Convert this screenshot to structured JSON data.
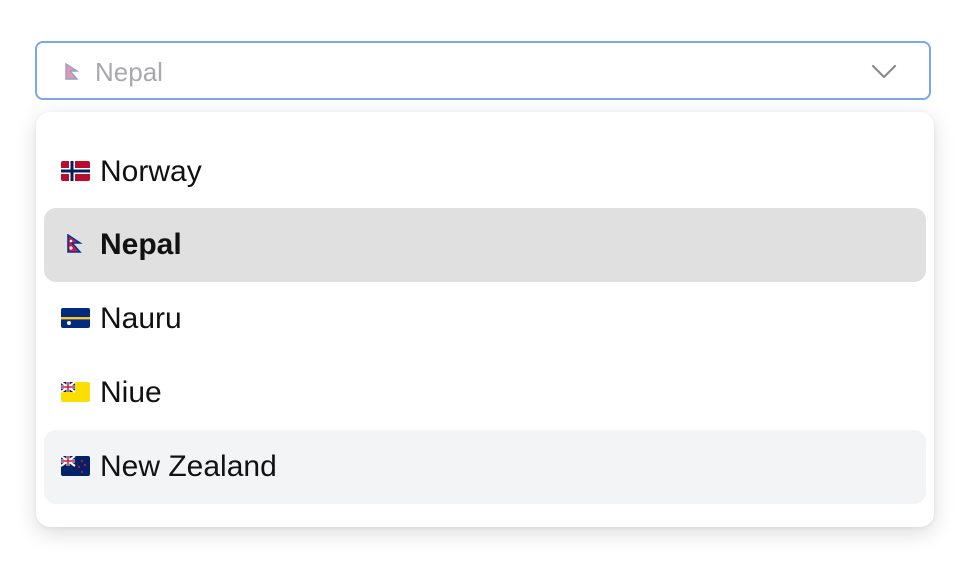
{
  "select": {
    "selected_value": "Nepal",
    "selected_flag": "nepal-flag-icon",
    "chevron_icon": "chevron-down-icon"
  },
  "options": [
    {
      "label": "Norway",
      "flag": "norway-flag-icon",
      "state": "normal"
    },
    {
      "label": "Nepal",
      "flag": "nepal-flag-icon",
      "state": "selected"
    },
    {
      "label": "Nauru",
      "flag": "nauru-flag-icon",
      "state": "normal"
    },
    {
      "label": "Niue",
      "flag": "niue-flag-icon",
      "state": "normal"
    },
    {
      "label": "New Zealand",
      "flag": "new-zealand-flag-icon",
      "state": "hovered"
    }
  ],
  "colors": {
    "focus_border": "#7aa7ee",
    "selected_bg": "#e0e0e0",
    "hover_bg": "#f3f4f6",
    "placeholder_text": "#a9a9ad"
  }
}
